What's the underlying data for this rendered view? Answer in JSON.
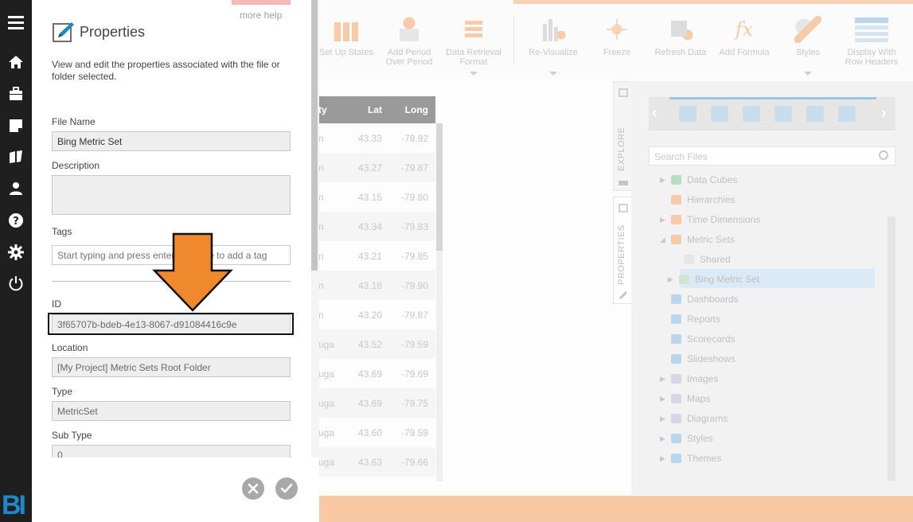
{
  "panel": {
    "more_help": "more help",
    "title": "Properties",
    "description": "View and edit the properties associated with the file or folder selected.",
    "file_name_label": "File Name",
    "file_name_value": "Bing Metric Set",
    "description_label": "Description",
    "description_value": "",
    "tags_label": "Tags",
    "tags_placeholder": "Start typing and press enter or space to add a tag",
    "id_label": "ID",
    "id_value": "3f65707b-bdeb-4e13-8067-d91084416c9e",
    "location_label": "Location",
    "location_value": "[My Project] Metric Sets Root Folder",
    "type_label": "Type",
    "type_value": "MetricSet",
    "subtype_label": "Sub Type",
    "subtype_value": "0"
  },
  "toolbar": {
    "items": [
      {
        "label": "Set Up States"
      },
      {
        "label": "Add Period Over Period"
      },
      {
        "label": "Data Retrieval Format"
      },
      {
        "label": "Re-Visualize"
      },
      {
        "label": "Freeze"
      },
      {
        "label": "Refresh Data"
      },
      {
        "label": "Add Formula"
      },
      {
        "label": "Styles"
      },
      {
        "label": "Display With Row Headers"
      }
    ]
  },
  "grid": {
    "headers": [
      "ty",
      "Lat",
      "Long"
    ],
    "rows": [
      [
        "n",
        "43.33",
        "-79.92"
      ],
      [
        "n",
        "43.27",
        "-79.87"
      ],
      [
        "n",
        "43.15",
        "-79.80"
      ],
      [
        "n",
        "43.34",
        "-79.83"
      ],
      [
        "n",
        "43.21",
        "-79.85"
      ],
      [
        "n",
        "43.18",
        "-79.90"
      ],
      [
        "n",
        "43.20",
        "-79.87"
      ],
      [
        "uga",
        "43.52",
        "-79.59"
      ],
      [
        "uga",
        "43.69",
        "-79.69"
      ],
      [
        "uga",
        "43.69",
        "-79.75"
      ],
      [
        "uga",
        "43.60",
        "-79.59"
      ],
      [
        "uga",
        "43.63",
        "-79.66"
      ]
    ]
  },
  "side_tabs": {
    "explore": "EXPLORE",
    "properties": "PROPERTIES"
  },
  "explore": {
    "search_placeholder": "Search Files",
    "tree": [
      {
        "label": "Data Cubes"
      },
      {
        "label": "Hierarchies"
      },
      {
        "label": "Time Dimensions"
      },
      {
        "label": "Metric Sets"
      },
      {
        "label": "Shared"
      },
      {
        "label": "Bing Metric Set"
      },
      {
        "label": "Dashboards"
      },
      {
        "label": "Reports"
      },
      {
        "label": "Scorecards"
      },
      {
        "label": "Slideshows"
      },
      {
        "label": "Images"
      },
      {
        "label": "Maps"
      },
      {
        "label": "Diagrams"
      },
      {
        "label": "Styles"
      },
      {
        "label": "Themes"
      }
    ]
  },
  "logo": "BI",
  "colors": {
    "accent_orange": "#f0892e",
    "nav_bg": "#1f1f1f",
    "bi_blue": "#1e88c8"
  }
}
